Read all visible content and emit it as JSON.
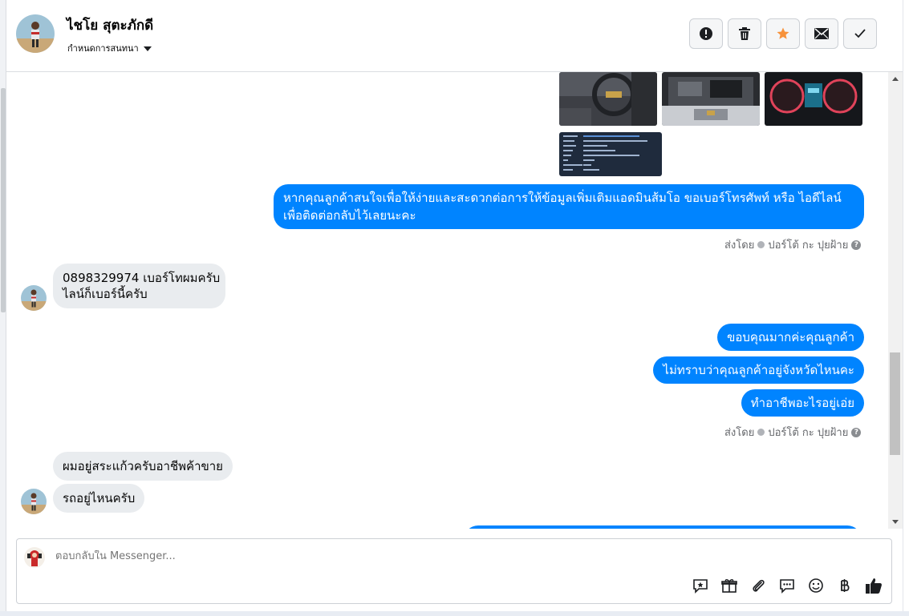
{
  "header": {
    "contact_name": "ไชโย สุตะภักดี",
    "assign_label": "กำหนดการสนทนา",
    "actions": [
      {
        "name": "report-button",
        "icon": "exclamation-circle-icon"
      },
      {
        "name": "delete-button",
        "icon": "trash-icon"
      },
      {
        "name": "star-button",
        "icon": "star-icon"
      },
      {
        "name": "mark-unread-button",
        "icon": "envelope-icon"
      },
      {
        "name": "mark-done-button",
        "icon": "checkmark-icon"
      }
    ]
  },
  "thread": {
    "outgoing_1": {
      "line1": "หากคุณลูกค้าสนใจเพื่อให้ง่ายและสะดวกต่อการให้ข้อมูลเพิ่มเติมแอดมินส้มโอ ขอเบอร์โทรศัพท์ หรือ ไอดีไลน์",
      "line2": "เพื่อติดต่อกลับไว้เลยนะคะ"
    },
    "sent_by_1": {
      "prefix": "ส่งโดย",
      "name": "ปอร์โต้ กะ ปุยฝ้าย"
    },
    "incoming_1": {
      "line1": "0898329974 เบอร์โทผมครับ",
      "line2": "ไลน์ก็เบอร์นี้ครับ"
    },
    "outgoing_2": "ขอบคุณมากค่ะคุณลูกค้า",
    "outgoing_3": "ไม่ทราบว่าคุณลูกค้าอยู่จังหวัดไหนคะ",
    "outgoing_4": "ทำอาชีพอะไรอยู่เอ่ย",
    "sent_by_2": {
      "prefix": "ส่งโดย",
      "name": "ปอร์โต้ กะ ปุยฝ้าย"
    },
    "incoming_2": "ผมอยู่สระแก้วครับอาชีพค้าขาย",
    "incoming_3": "รถอยู่ไหนครับ"
  },
  "composer": {
    "placeholder": "ตอบกลับใน Messenger...",
    "tools": [
      "saved-reply-icon",
      "gift-box-icon",
      "paperclip-icon",
      "chat-bubbles-icon",
      "smiley-icon",
      "baht-icon",
      "thumbs-up-icon"
    ]
  },
  "colors": {
    "accent": "#0084ff",
    "incoming_bubble": "#e9ecef",
    "star": "#f7923b"
  }
}
